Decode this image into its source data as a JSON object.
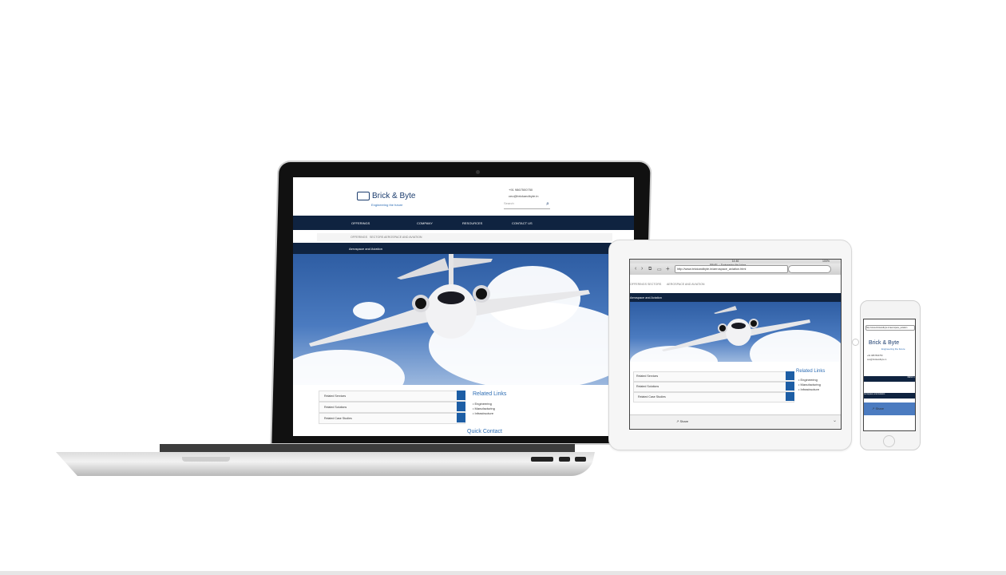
{
  "site": {
    "brand": "Brick & Byte",
    "tagline": "Engineering the future",
    "phone": "+91 9867500750",
    "email": "ceo@brickandbyte.in",
    "search_placeholder": "Search",
    "nav": [
      "OFFERINGS",
      "COMPANY",
      "RESOURCES",
      "CONTACT US"
    ],
    "breadcrumb": [
      "OFFERINGS",
      "SECTORS",
      "AEROSPACE AND AVIATION"
    ],
    "page_title": "Aerospace and Aviation",
    "panels": [
      "Related Services",
      "Related Solutions",
      "Related Case Studies"
    ],
    "related_title": "Related Links",
    "related_links": [
      "Engineering",
      "Manufacturing",
      "Infrastructure"
    ],
    "quick_contact": "Quick Contact",
    "social": [
      "t",
      "f",
      "+"
    ],
    "social_colors": [
      "#1d3f6e",
      "#2e4f8f",
      "#e8553a"
    ]
  },
  "tablet": {
    "time": "14:46",
    "battery": "100%",
    "page_title_bar": "BBHPL :: Engineering the future",
    "url": "http://www.brickandbyte.in/aerospace_aviation.html",
    "share_label": "Share"
  },
  "phone": {
    "url": "http://www.brickandbyte.in/aerospace_aviation",
    "nav_label": "MENU",
    "share_label": "Share"
  }
}
